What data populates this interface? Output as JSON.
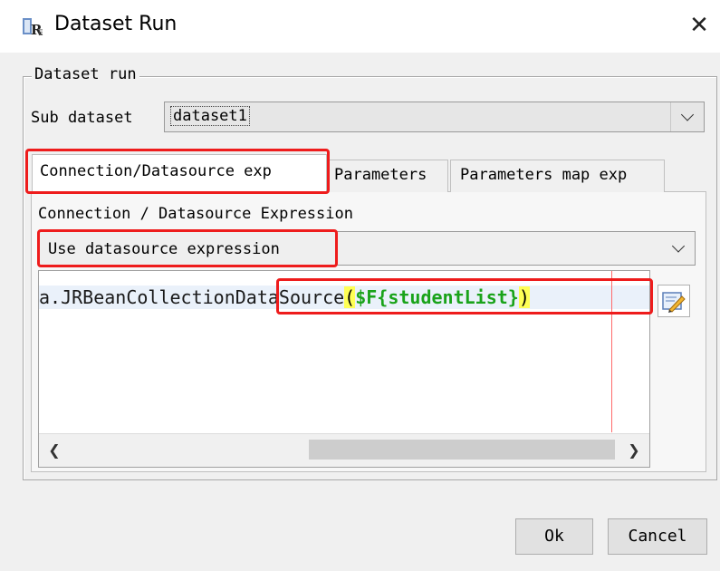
{
  "window": {
    "title": "Dataset Run"
  },
  "group": {
    "legend": "Dataset run"
  },
  "sub_dataset": {
    "label": "Sub dataset",
    "value": "dataset1"
  },
  "tabs": [
    {
      "label": "Connection/Datasource exp",
      "active": true
    },
    {
      "label": "Parameters"
    },
    {
      "label": "Parameters map exp"
    }
  ],
  "connection": {
    "section_label": "Connection / Datasource Expression",
    "type_value": "Use datasource expression",
    "expression": {
      "prefix": "a.JRBeanCollectionDataSource",
      "open_paren": "(",
      "field": "$F{studentList}",
      "close_paren": ")"
    }
  },
  "icons": {
    "app": "jasper-report-icon",
    "close": "close-icon",
    "edit": "edit-expression-icon"
  },
  "highlight_color": "#ee1c1c",
  "buttons": {
    "ok": "Ok",
    "cancel": "Cancel"
  }
}
